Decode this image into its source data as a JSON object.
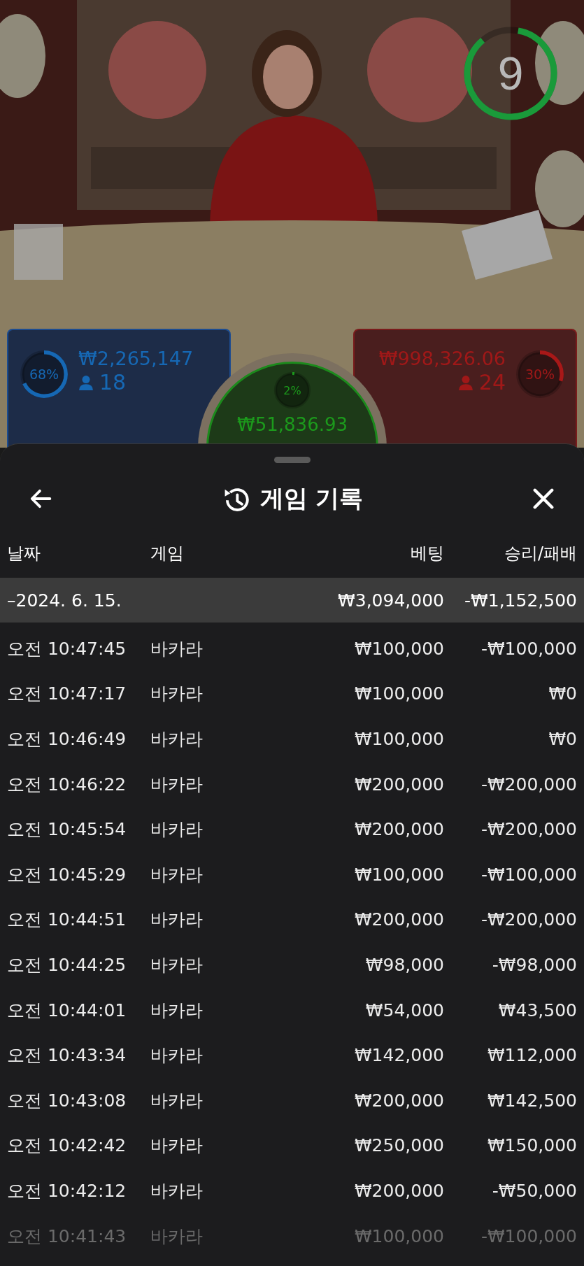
{
  "timer": {
    "value": "9",
    "level": 0.86
  },
  "bets": [
    {
      "kind": "player",
      "percent": "68%",
      "level": 0.68,
      "amount": "₩2,265,147",
      "players": "18"
    },
    {
      "kind": "tie",
      "percent": "2%",
      "level": 0.02,
      "amount": "₩51,836.93"
    },
    {
      "kind": "banker",
      "percent": "30%",
      "level": 0.3,
      "amount": "₩998,326.06",
      "players": "24"
    }
  ],
  "sheet": {
    "title": "게임 기록",
    "columns": [
      "날짜",
      "게임",
      "베팅",
      "승리/패배"
    ],
    "summary": {
      "date": "–2024. 6. 15.",
      "bet": "₩3,094,000",
      "result": "-₩1,152,500"
    },
    "rows": [
      {
        "time": "오전 10:47:45",
        "game": "바카라",
        "bet": "₩100,000",
        "result": "-₩100,000"
      },
      {
        "time": "오전 10:47:17",
        "game": "바카라",
        "bet": "₩100,000",
        "result": "₩0"
      },
      {
        "time": "오전 10:46:49",
        "game": "바카라",
        "bet": "₩100,000",
        "result": "₩0"
      },
      {
        "time": "오전 10:46:22",
        "game": "바카라",
        "bet": "₩200,000",
        "result": "-₩200,000"
      },
      {
        "time": "오전 10:45:54",
        "game": "바카라",
        "bet": "₩200,000",
        "result": "-₩200,000"
      },
      {
        "time": "오전 10:45:29",
        "game": "바카라",
        "bet": "₩100,000",
        "result": "-₩100,000"
      },
      {
        "time": "오전 10:44:51",
        "game": "바카라",
        "bet": "₩200,000",
        "result": "-₩200,000"
      },
      {
        "time": "오전 10:44:25",
        "game": "바카라",
        "bet": "₩98,000",
        "result": "-₩98,000"
      },
      {
        "time": "오전 10:44:01",
        "game": "바카라",
        "bet": "₩54,000",
        "result": "₩43,500"
      },
      {
        "time": "오전 10:43:34",
        "game": "바카라",
        "bet": "₩142,000",
        "result": "₩112,000"
      },
      {
        "time": "오전 10:43:08",
        "game": "바카라",
        "bet": "₩200,000",
        "result": "₩142,500"
      },
      {
        "time": "오전 10:42:42",
        "game": "바카라",
        "bet": "₩250,000",
        "result": "₩150,000"
      },
      {
        "time": "오전 10:42:12",
        "game": "바카라",
        "bet": "₩200,000",
        "result": "-₩50,000"
      },
      {
        "time": "오전 10:41:43",
        "game": "바카라",
        "bet": "₩100,000",
        "result": "-₩100,000"
      }
    ]
  }
}
